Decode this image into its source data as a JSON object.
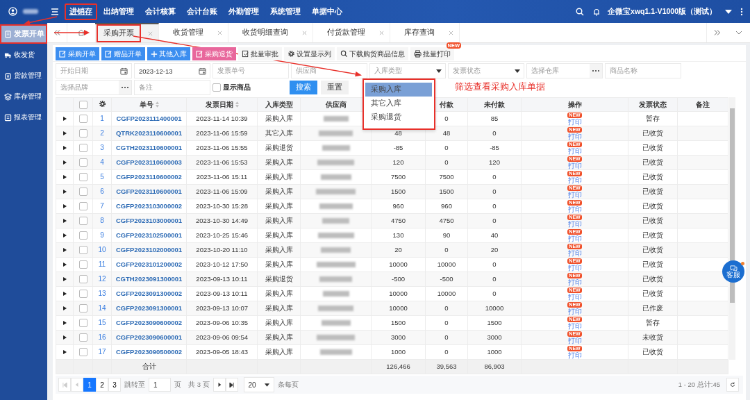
{
  "top_bar": {
    "nav": [
      {
        "label": "进销存",
        "selected": true,
        "annotated": true
      },
      {
        "label": "出纳管理",
        "selected": false,
        "annotated": false
      },
      {
        "label": "会计核算",
        "selected": false,
        "annotated": false
      },
      {
        "label": "会计台账",
        "selected": false,
        "annotated": false
      },
      {
        "label": "外勤管理",
        "selected": false,
        "annotated": false
      },
      {
        "label": "系统管理",
        "selected": false,
        "annotated": false
      },
      {
        "label": "单据中心",
        "selected": false,
        "annotated": false
      }
    ],
    "account": "企微宝xwq1.1-V1000版（测试）"
  },
  "sidebar": {
    "items": [
      {
        "label": "发票开单",
        "selected": true,
        "annotated": true
      },
      {
        "label": "收发货",
        "selected": false,
        "annotated": false
      },
      {
        "label": "货款管理",
        "selected": false,
        "annotated": false
      },
      {
        "label": "库存管理",
        "selected": false,
        "annotated": false
      },
      {
        "label": "报表管理",
        "selected": false,
        "annotated": false
      }
    ]
  },
  "tabs": [
    {
      "label": "采购开票",
      "selected": true,
      "annotated": true
    },
    {
      "label": "收货管理",
      "selected": false,
      "annotated": false
    },
    {
      "label": "收货明细查询",
      "selected": false,
      "annotated": false
    },
    {
      "label": "付货款管理",
      "selected": false,
      "annotated": false
    },
    {
      "label": "库存查询",
      "selected": false,
      "annotated": false
    }
  ],
  "toolbar": [
    {
      "label": "采购开单",
      "kind": "primary"
    },
    {
      "label": "赠品开单",
      "kind": "primary"
    },
    {
      "label": "其他入库",
      "kind": "primary"
    },
    {
      "label": "采购退货",
      "kind": "danger"
    },
    {
      "label": "批量审批",
      "kind": "plain"
    },
    {
      "label": "设置显示列",
      "kind": "plain"
    },
    {
      "label": "下载购货商品信息",
      "kind": "plain"
    },
    {
      "label": "批量打印",
      "kind": "plain",
      "badge": "NEW"
    }
  ],
  "filters": [
    [
      {
        "kind": "date",
        "placeholder": "开始日期"
      },
      {
        "kind": "date",
        "value": "2023-12-13"
      },
      {
        "kind": "text",
        "placeholder": "发票单号"
      },
      {
        "kind": "text",
        "placeholder": "供应商"
      },
      {
        "kind": "select",
        "placeholder": "入库类型",
        "open": true,
        "annotated": true,
        "options": [
          {
            "label": "采购入库",
            "selected": true
          },
          {
            "label": "其它入库",
            "selected": false
          },
          {
            "label": "采购退货",
            "selected": false
          }
        ]
      },
      {
        "kind": "select",
        "placeholder": "发票状态",
        "open": false
      },
      {
        "kind": "picker",
        "placeholder": "选择仓库"
      },
      {
        "kind": "text",
        "placeholder": "商品名称"
      }
    ],
    [
      {
        "kind": "picker",
        "placeholder": "选择品牌"
      },
      {
        "kind": "text",
        "placeholder": "备注"
      },
      {
        "kind": "checkbox",
        "label": "显示商品",
        "checked": false
      },
      {
        "kind": "primary",
        "label": "搜索"
      },
      {
        "kind": "plain",
        "label": "重置"
      }
    ]
  ],
  "annotation": "筛选查看采购入库单据",
  "table": {
    "select_all": {
      "checked": false
    },
    "columns": [
      {
        "label": "单号",
        "sortable": true
      },
      {
        "label": "发票日期",
        "sortable": true
      },
      {
        "label": "入库类型"
      },
      {
        "label": "供应商"
      },
      null,
      {
        "label": "付款"
      },
      {
        "label": "未付款"
      },
      {
        "label": "操作"
      },
      {
        "label": "发票状态"
      },
      {
        "label": "备注"
      }
    ],
    "rows": [
      {
        "checked": false,
        "no": "1",
        "number": "CGFP2023111400001",
        "date": "2023-11-14 10:39",
        "type": "采购入库",
        "paid": "0",
        "unpaid": "85",
        "action": "打印",
        "badge": "NEW",
        "status": "暂存"
      },
      {
        "checked": false,
        "no": "2",
        "number": "QTRK2023110600001",
        "date": "2023-11-06 15:59",
        "type": "其它入库",
        "amount": "48",
        "paid": "48",
        "unpaid": "0",
        "action": "打印",
        "badge": "NEW",
        "status": "已收货"
      },
      {
        "checked": false,
        "no": "3",
        "number": "CGTH2023110600001",
        "date": "2023-11-06 15:55",
        "type": "采购退货",
        "amount": "-85",
        "paid": "0",
        "unpaid": "-85",
        "action": "打印",
        "badge": "NEW",
        "status": "已收货"
      },
      {
        "checked": false,
        "no": "4",
        "number": "CGFP2023110600003",
        "date": "2023-11-06 15:53",
        "type": "采购入库",
        "amount": "120",
        "paid": "0",
        "unpaid": "120",
        "action": "打印",
        "badge": "NEW",
        "status": "已收货"
      },
      {
        "checked": false,
        "no": "5",
        "number": "CGFP2023110600002",
        "date": "2023-11-06 15:11",
        "type": "采购入库",
        "amount": "7500",
        "paid": "7500",
        "unpaid": "0",
        "action": "打印",
        "badge": "NEW",
        "status": "已收货"
      },
      {
        "checked": false,
        "no": "6",
        "number": "CGFP2023110600001",
        "date": "2023-11-06 15:09",
        "type": "采购入库",
        "amount": "1500",
        "paid": "1500",
        "unpaid": "0",
        "action": "打印",
        "badge": "NEW",
        "status": "已收货"
      },
      {
        "checked": false,
        "no": "7",
        "number": "CGFP2023103000002",
        "date": "2023-10-30 15:28",
        "type": "采购入库",
        "amount": "960",
        "paid": "960",
        "unpaid": "0",
        "action": "打印",
        "badge": "NEW",
        "status": "已收货"
      },
      {
        "checked": false,
        "no": "8",
        "number": "CGFP2023103000001",
        "date": "2023-10-30 14:49",
        "type": "采购入库",
        "amount": "4750",
        "paid": "4750",
        "unpaid": "0",
        "action": "打印",
        "badge": "NEW",
        "status": "已收货"
      },
      {
        "checked": false,
        "no": "9",
        "number": "CGFP2023102500001",
        "date": "2023-10-25 15:46",
        "type": "采购入库",
        "amount": "130",
        "paid": "90",
        "unpaid": "40",
        "action": "打印",
        "badge": "NEW",
        "status": "已收货"
      },
      {
        "checked": false,
        "no": "10",
        "number": "CGFP2023102000001",
        "date": "2023-10-20 11:10",
        "type": "采购入库",
        "amount": "20",
        "paid": "0",
        "unpaid": "20",
        "action": "打印",
        "badge": "NEW",
        "status": "已收货"
      },
      {
        "checked": false,
        "no": "11",
        "number": "CGFP2023101200002",
        "date": "2023-10-12 17:50",
        "type": "采购入库",
        "amount": "10000",
        "paid": "10000",
        "unpaid": "0",
        "action": "打印",
        "badge": "NEW",
        "status": "已收货"
      },
      {
        "checked": false,
        "no": "12",
        "number": "CGTH2023091300001",
        "date": "2023-09-13 10:11",
        "type": "采购退货",
        "amount": "-500",
        "paid": "-500",
        "unpaid": "0",
        "action": "打印",
        "badge": "NEW",
        "status": "已收货"
      },
      {
        "checked": false,
        "no": "13",
        "number": "CGFP2023091300002",
        "date": "2023-09-13 10:11",
        "type": "采购入库",
        "amount": "10000",
        "paid": "10000",
        "unpaid": "0",
        "action": "打印",
        "badge": "NEW",
        "status": "已收货"
      },
      {
        "checked": false,
        "no": "14",
        "number": "CGFP2023091300001",
        "date": "2023-09-13 10:07",
        "type": "采购入库",
        "amount": "10000",
        "paid": "0",
        "unpaid": "10000",
        "action": "打印",
        "badge": "NEW",
        "status": "已作废"
      },
      {
        "checked": false,
        "no": "15",
        "number": "CGFP2023090600002",
        "date": "2023-09-06 10:35",
        "type": "采购入库",
        "amount": "1500",
        "paid": "0",
        "unpaid": "1500",
        "action": "打印",
        "badge": "NEW",
        "status": "暂存"
      },
      {
        "checked": false,
        "no": "16",
        "number": "CGFP2023090600001",
        "date": "2023-09-06 09:54",
        "type": "采购入库",
        "amount": "3000",
        "paid": "0",
        "unpaid": "3000",
        "action": "打印",
        "badge": "NEW",
        "status": "未收货"
      },
      {
        "checked": false,
        "no": "17",
        "number": "CGFP2023090500002",
        "date": "2023-09-05 18:43",
        "type": "采购入库",
        "amount": "1000",
        "paid": "0",
        "unpaid": "1000",
        "action": "打印",
        "badge": "NEW",
        "status": "已收货"
      }
    ],
    "total": {
      "label": "合计",
      "amount": "126,466",
      "paid": "39,563",
      "unpaid": "86,903"
    }
  },
  "pagination": {
    "pages": [
      {
        "label": "1",
        "selected": true
      },
      {
        "label": "2",
        "selected": false
      },
      {
        "label": "3",
        "selected": false
      }
    ],
    "jump_label": "跳转至",
    "jump_value": "1",
    "page_unit": "页",
    "page_count": "共 3 页",
    "page_size": "20",
    "page_size_unit": "条每页",
    "summary": "1 - 20 总计:45"
  },
  "service_button": {
    "label": "客服"
  }
}
